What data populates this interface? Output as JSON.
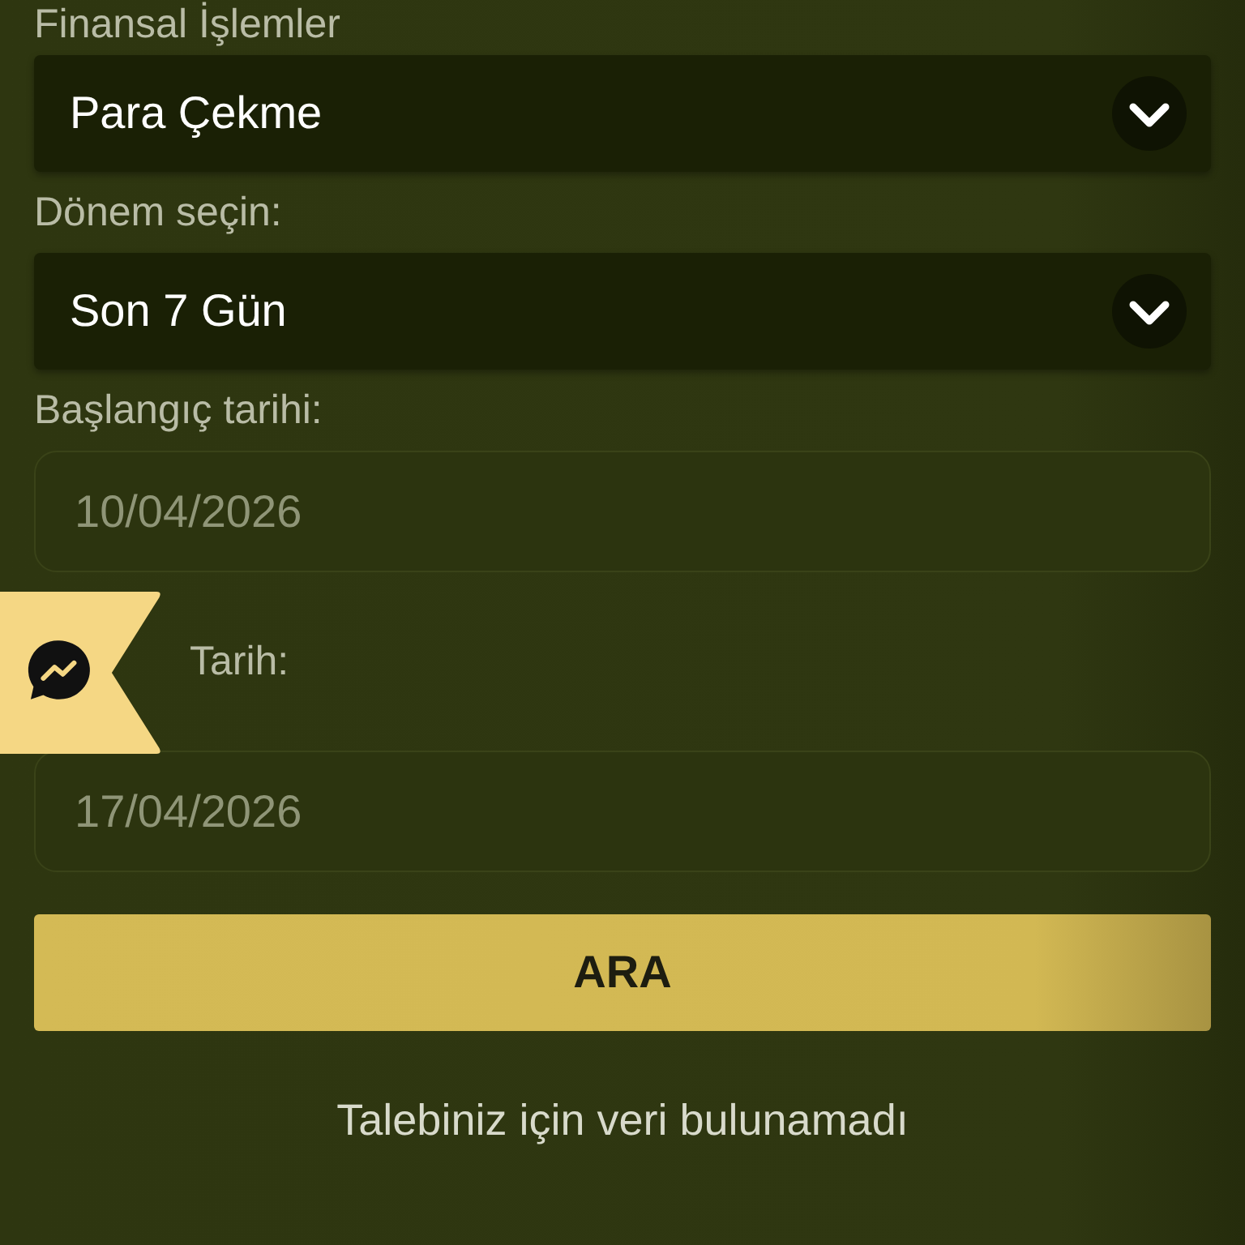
{
  "form": {
    "fields": [
      {
        "kind": "select",
        "label": "Finansal İşlemler",
        "value": "Para Çekme"
      },
      {
        "kind": "select",
        "label": "Dönem seçin:",
        "value": "Son 7 Gün"
      },
      {
        "kind": "date",
        "label": "Başlangıç tarihi:",
        "value": "10/04/2026"
      },
      {
        "kind": "date",
        "label": "Tarih:",
        "value": "17/04/2026"
      }
    ],
    "button": "ARA"
  },
  "empty_message": "Talebiniz için veri bulunamadı",
  "chat_flag": {
    "kind": "messenger"
  }
}
